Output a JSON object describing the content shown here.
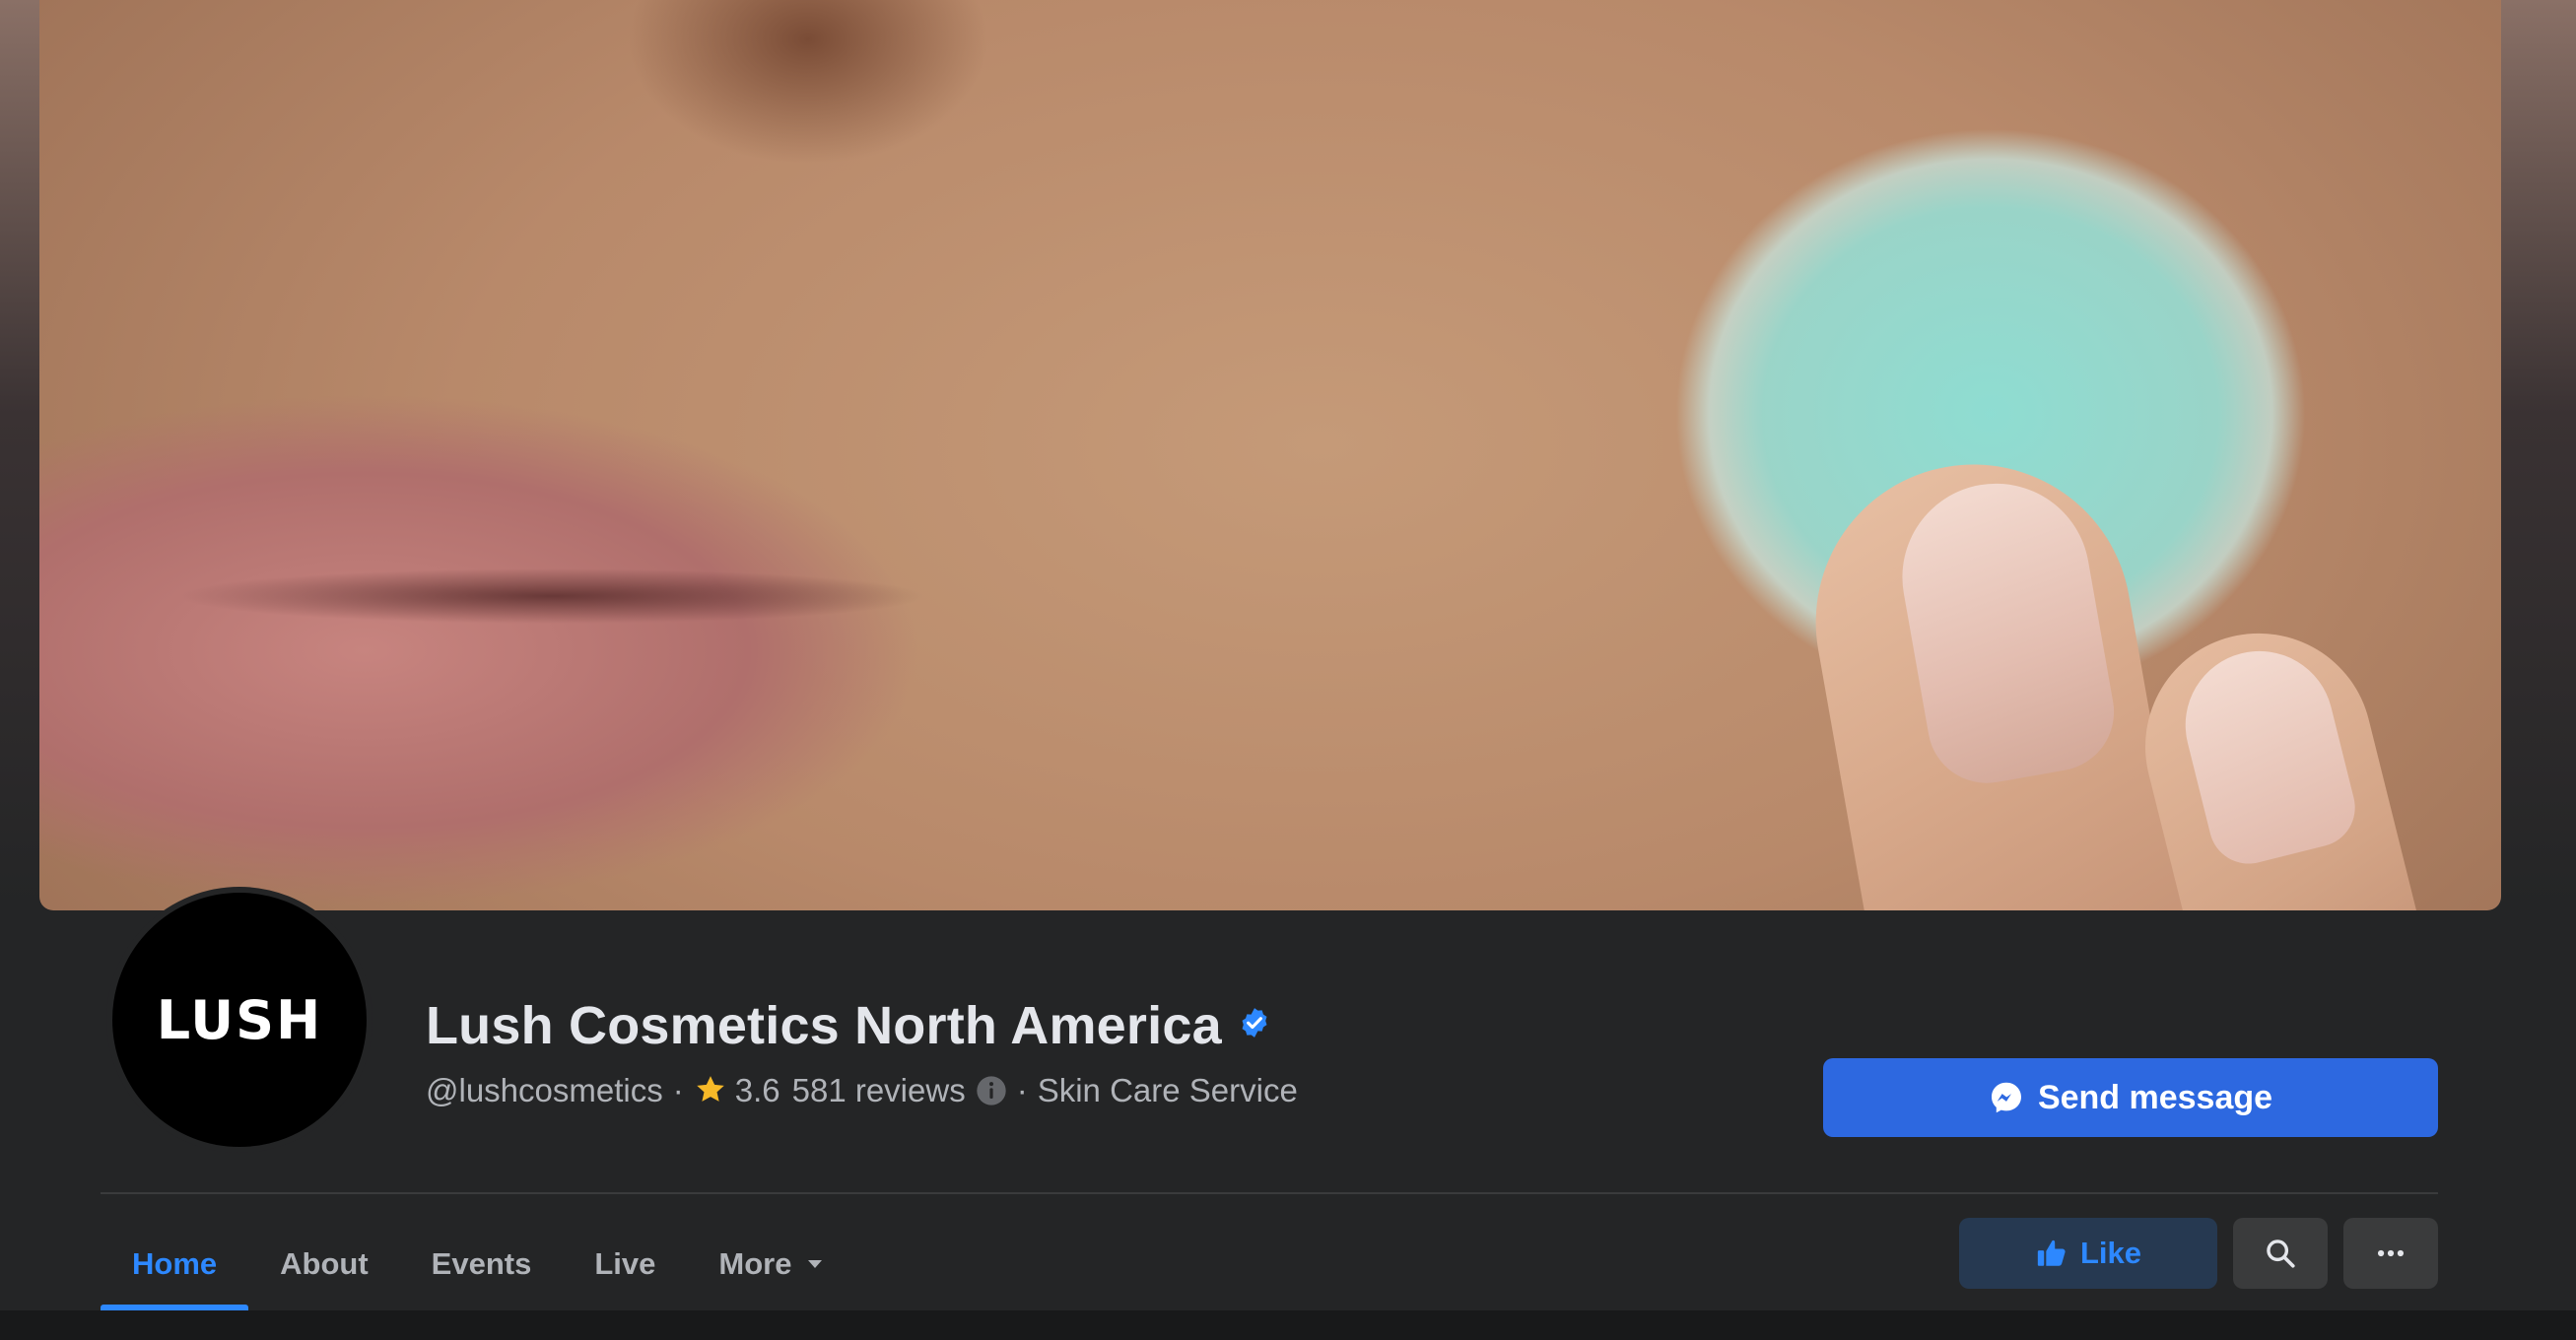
{
  "cover": {
    "alt_description_hidden": ""
  },
  "avatar": {
    "logo_text": "LUSH"
  },
  "page": {
    "title": "Lush Cosmetics North America",
    "handle": "@lushcosmetics",
    "separator": "·",
    "rating": "3.6",
    "reviews": "581 reviews",
    "category": "Skin Care Service"
  },
  "actions": {
    "send_message_label": "Send message",
    "like_label": "Like"
  },
  "tabs": [
    {
      "label": "Home",
      "active": true
    },
    {
      "label": "About",
      "active": false
    },
    {
      "label": "Events",
      "active": false
    },
    {
      "label": "Live",
      "active": false
    },
    {
      "label": "More",
      "active": false
    }
  ],
  "icons": {
    "verified": "verified-badge-icon",
    "star": "star-icon",
    "info": "info-icon",
    "messenger": "messenger-icon",
    "caret": "caret-down-icon",
    "like": "thumbs-up-icon",
    "search": "search-icon",
    "more": "ellipsis-icon"
  },
  "colors": {
    "background": "#242526",
    "accent": "#2d88ff",
    "primary_button": "#2d68e0",
    "like_button_bg": "#263951",
    "text_primary": "#e4e6eb",
    "text_secondary": "#b0b3b8",
    "star": "#f7b928"
  }
}
